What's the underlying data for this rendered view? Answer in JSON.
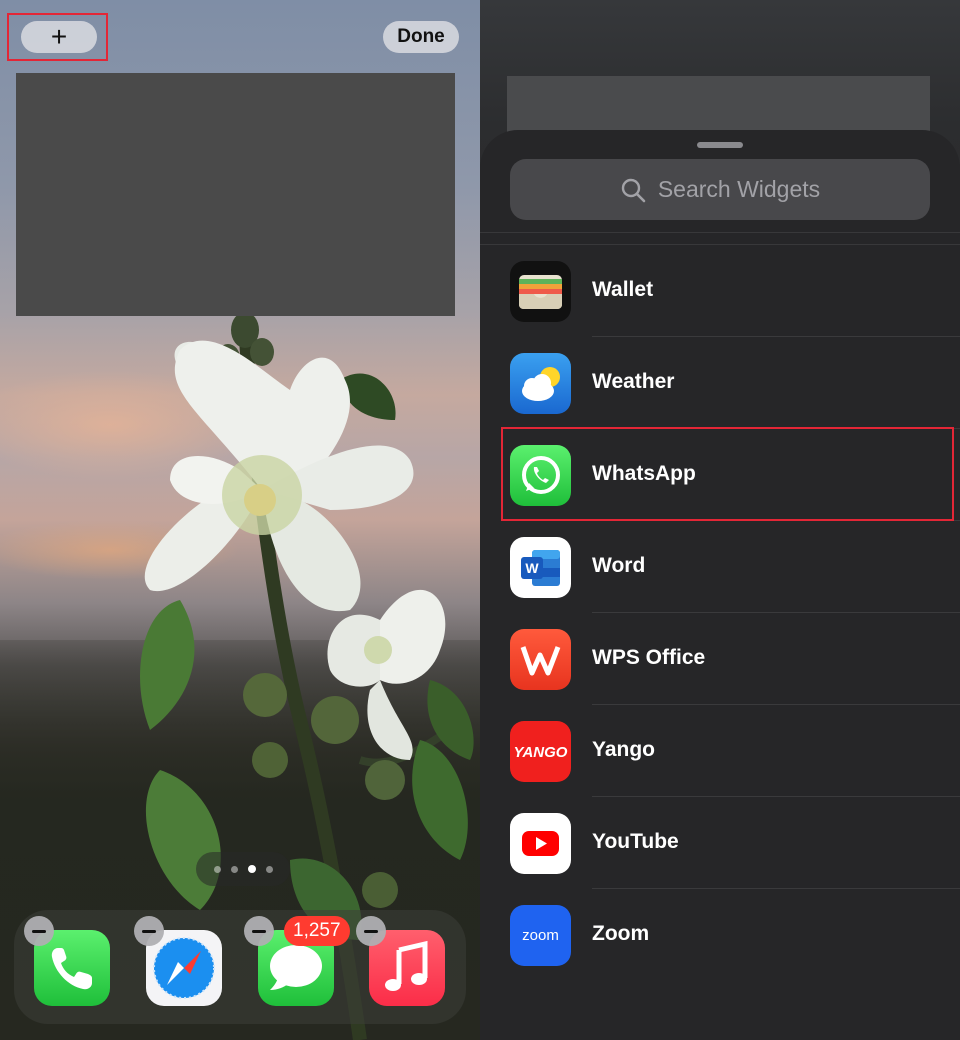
{
  "home": {
    "add_label": "+",
    "done_label": "Done",
    "page_dots": {
      "count": 4,
      "active_index": 2
    },
    "dock": [
      {
        "name": "Phone",
        "icon": "phone-icon"
      },
      {
        "name": "Safari",
        "icon": "safari-icon"
      },
      {
        "name": "Messages",
        "icon": "messages-icon",
        "badge": "1,257"
      },
      {
        "name": "Music",
        "icon": "music-icon"
      }
    ]
  },
  "gallery": {
    "search_placeholder": "Search Widgets",
    "apps": [
      {
        "name": "Wallet",
        "icon": "wallet-icon"
      },
      {
        "name": "Weather",
        "icon": "weather-icon"
      },
      {
        "name": "WhatsApp",
        "icon": "whatsapp-icon"
      },
      {
        "name": "Word",
        "icon": "word-icon"
      },
      {
        "name": "WPS Office",
        "icon": "wps-office-icon"
      },
      {
        "name": "Yango",
        "icon": "yango-icon",
        "icon_text": "YANGO"
      },
      {
        "name": "YouTube",
        "icon": "youtube-icon"
      },
      {
        "name": "Zoom",
        "icon": "zoom-icon",
        "icon_text": "zoom"
      }
    ],
    "word_icon_letter": "W",
    "highlighted_app": "WhatsApp"
  },
  "colors": {
    "highlight": "#e32636",
    "badge": "#ff3b30"
  }
}
